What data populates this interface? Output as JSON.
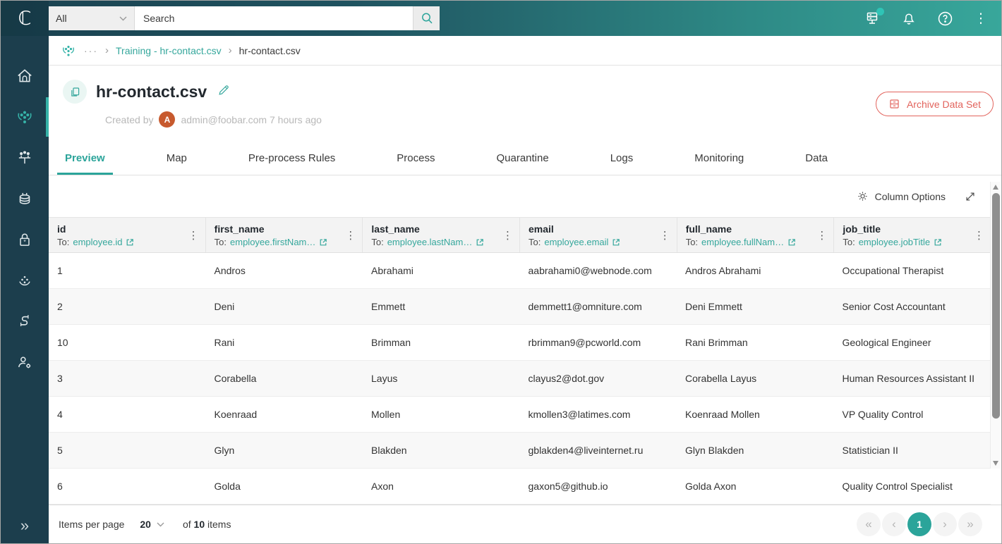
{
  "topbar": {
    "logo_glyph": "ℂ",
    "search_scope": "All",
    "search_placeholder": "Search"
  },
  "sidebar": {
    "items": [
      "home",
      "data-sets",
      "connections",
      "data-store",
      "security",
      "network",
      "pipelines",
      "user-admin"
    ],
    "active_item": "data-sets",
    "collapse_glyph": "»"
  },
  "breadcrumb": {
    "ellipsis": "···",
    "separator": "›",
    "parent": "Training - hr-contact.csv",
    "current": "hr-contact.csv"
  },
  "header": {
    "title": "hr-contact.csv",
    "created_by_label": "Created by",
    "avatar_initial": "A",
    "created_meta": "admin@foobar.com 7 hours ago",
    "archive_button_label": "Archive Data Set"
  },
  "tabs": {
    "items": [
      "Preview",
      "Map",
      "Pre-process Rules",
      "Process",
      "Quarantine",
      "Logs",
      "Monitoring",
      "Data"
    ],
    "active": "Preview"
  },
  "toolbar": {
    "column_options_label": "Column Options"
  },
  "table": {
    "columns": [
      {
        "name": "id",
        "mapping_label": "To:",
        "mapping": "employee.id"
      },
      {
        "name": "first_name",
        "mapping_label": "To:",
        "mapping": "employee.firstNam…"
      },
      {
        "name": "last_name",
        "mapping_label": "To:",
        "mapping": "employee.lastNam…"
      },
      {
        "name": "email",
        "mapping_label": "To:",
        "mapping": "employee.email"
      },
      {
        "name": "full_name",
        "mapping_label": "To:",
        "mapping": "employee.fullNam…"
      },
      {
        "name": "job_title",
        "mapping_label": "To:",
        "mapping": "employee.jobTitle"
      }
    ],
    "rows": [
      [
        "1",
        "Andros",
        "Abrahami",
        "aabrahami0@webnode.com",
        "Andros Abrahami",
        "Occupational Therapist"
      ],
      [
        "2",
        "Deni",
        "Emmett",
        "demmett1@omniture.com",
        "Deni Emmett",
        "Senior Cost Accountant"
      ],
      [
        "10",
        "Rani",
        "Brimman",
        "rbrimman9@pcworld.com",
        "Rani Brimman",
        "Geological Engineer"
      ],
      [
        "3",
        "Corabella",
        "Layus",
        "clayus2@dot.gov",
        "Corabella Layus",
        "Human Resources Assistant II"
      ],
      [
        "4",
        "Koenraad",
        "Mollen",
        "kmollen3@latimes.com",
        "Koenraad Mollen",
        "VP Quality Control"
      ],
      [
        "5",
        "Glyn",
        "Blakden",
        "gblakden4@liveinternet.ru",
        "Glyn Blakden",
        "Statistician II"
      ],
      [
        "6",
        "Golda",
        "Axon",
        "gaxon5@github.io",
        "Golda Axon",
        "Quality Control Specialist"
      ]
    ]
  },
  "footer": {
    "items_per_page_label": "Items per page",
    "page_size": "20",
    "of_label": "of",
    "total_items": "10",
    "items_label": "items",
    "current_page": "1",
    "pager_glyphs": {
      "first": "«",
      "prev": "‹",
      "next": "›",
      "last": "»"
    }
  },
  "colors": {
    "accent_teal": "#2BA49A",
    "sidebar_navy": "#1C3E4D",
    "topbar_gradient_start": "#1A4250",
    "topbar_gradient_end": "#38A79B",
    "danger_red": "#E2635C",
    "avatar_orange": "#C75A2E",
    "header_gray": "#F3F3F3"
  }
}
